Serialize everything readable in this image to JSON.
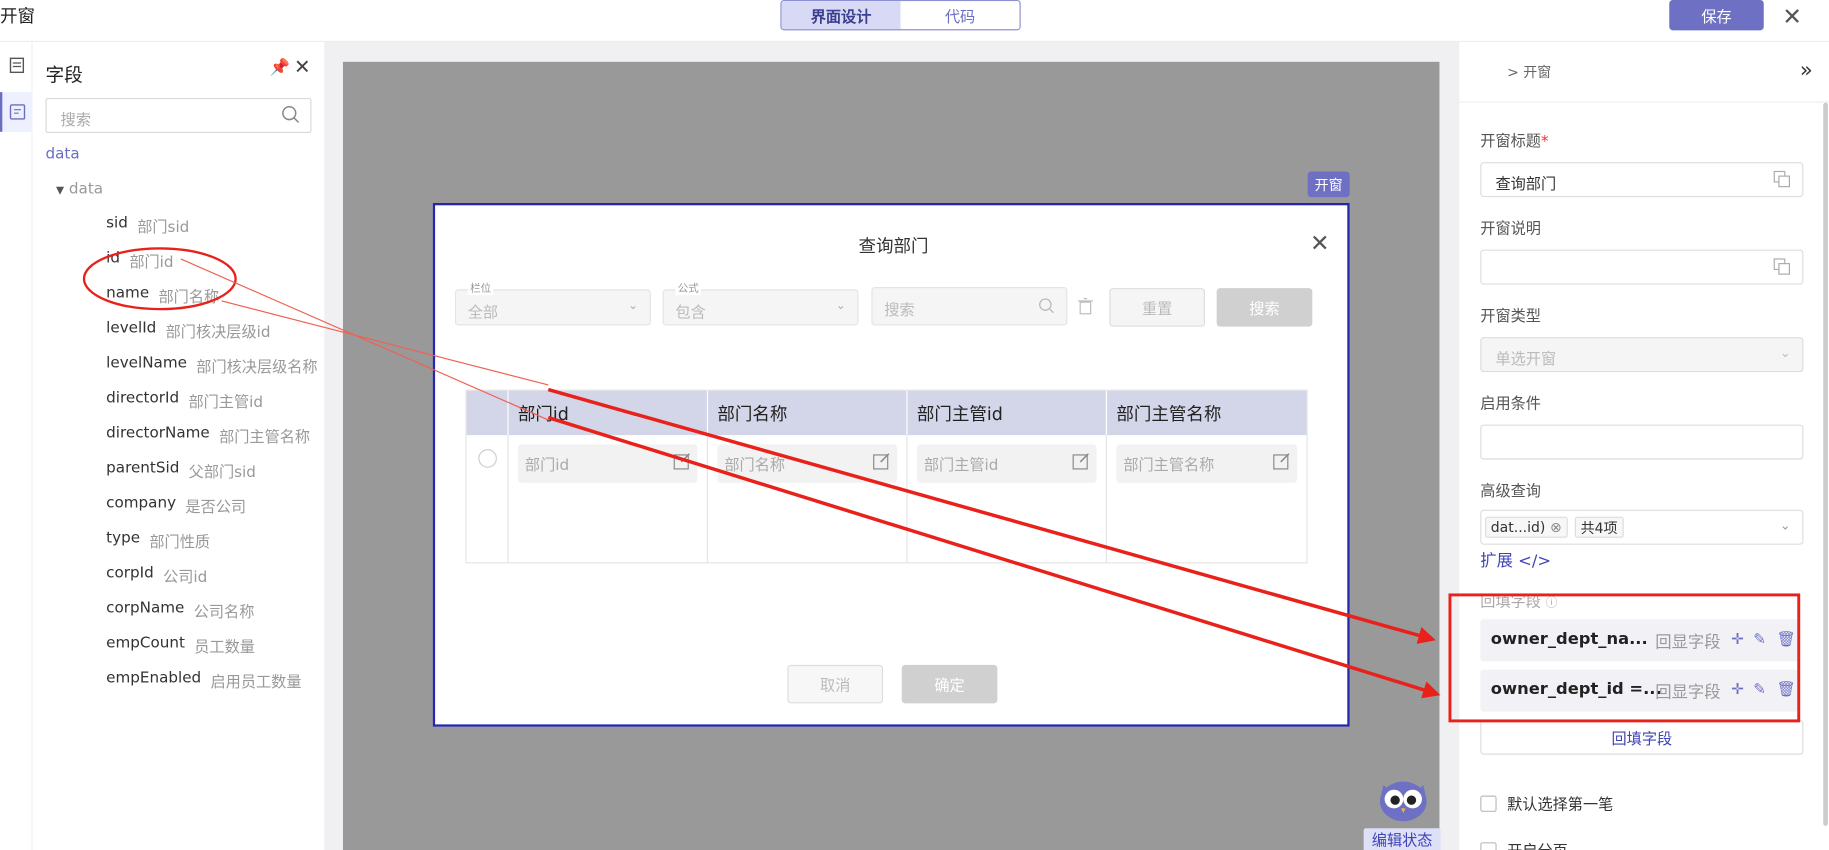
{
  "app": {
    "title": "开窗",
    "tab_design": "界面设计",
    "tab_code": "代码",
    "save": "保存"
  },
  "field_panel": {
    "title": "字段",
    "search_placeholder": "搜索",
    "root": "data",
    "node": "data",
    "fields": [
      {
        "key": "sid",
        "label": "部门sid"
      },
      {
        "key": "id",
        "label": "部门id"
      },
      {
        "key": "name",
        "label": "部门名称"
      },
      {
        "key": "levelId",
        "label": "部门核决层级id"
      },
      {
        "key": "levelName",
        "label": "部门核决层级名称"
      },
      {
        "key": "directorId",
        "label": "部门主管id"
      },
      {
        "key": "directorName",
        "label": "部门主管名称"
      },
      {
        "key": "parentSid",
        "label": "父部门sid"
      },
      {
        "key": "company",
        "label": "是否公司"
      },
      {
        "key": "type",
        "label": "部门性质"
      },
      {
        "key": "corpId",
        "label": "公司id"
      },
      {
        "key": "corpName",
        "label": "公司名称"
      },
      {
        "key": "empCount",
        "label": "员工数量"
      },
      {
        "key": "empEnabled",
        "label": "启用员工数量"
      }
    ]
  },
  "canvas": {
    "tag": "开窗",
    "edit_status": "编辑状态"
  },
  "dialog": {
    "title": "查询部门",
    "field_select": {
      "label": "栏位",
      "value": "全部"
    },
    "op_select": {
      "label": "公式",
      "value": "包含"
    },
    "search_placeholder": "搜索",
    "reset": "重置",
    "search": "搜索",
    "columns": [
      "部门id",
      "部门名称",
      "部门主管id",
      "部门主管名称"
    ],
    "cells": [
      "部门id",
      "部门名称",
      "部门主管id",
      "部门主管名称"
    ],
    "cancel": "取消",
    "ok": "确定"
  },
  "right_panel": {
    "breadcrumb": "> 开窗",
    "title_label": "开窗标题",
    "title_value": "查询部门",
    "desc_label": "开窗说明",
    "desc_value": "",
    "type_label": "开窗类型",
    "type_value": "单选开窗",
    "cond_label": "启用条件",
    "cond_value": "",
    "adv_label": "高级查询",
    "adv_chip": "dat...id)",
    "adv_count": "共4项",
    "extend": "扩展 </>",
    "fill_label": "回填字段",
    "fill_rows": [
      {
        "name": "owner_dept_na...",
        "hint": "回显字段"
      },
      {
        "name": "owner_dept_id =...",
        "hint": "回显字段"
      }
    ],
    "add_fill": "回填字段",
    "default_first": "默认选择第一笔",
    "paging": "开启分页"
  }
}
